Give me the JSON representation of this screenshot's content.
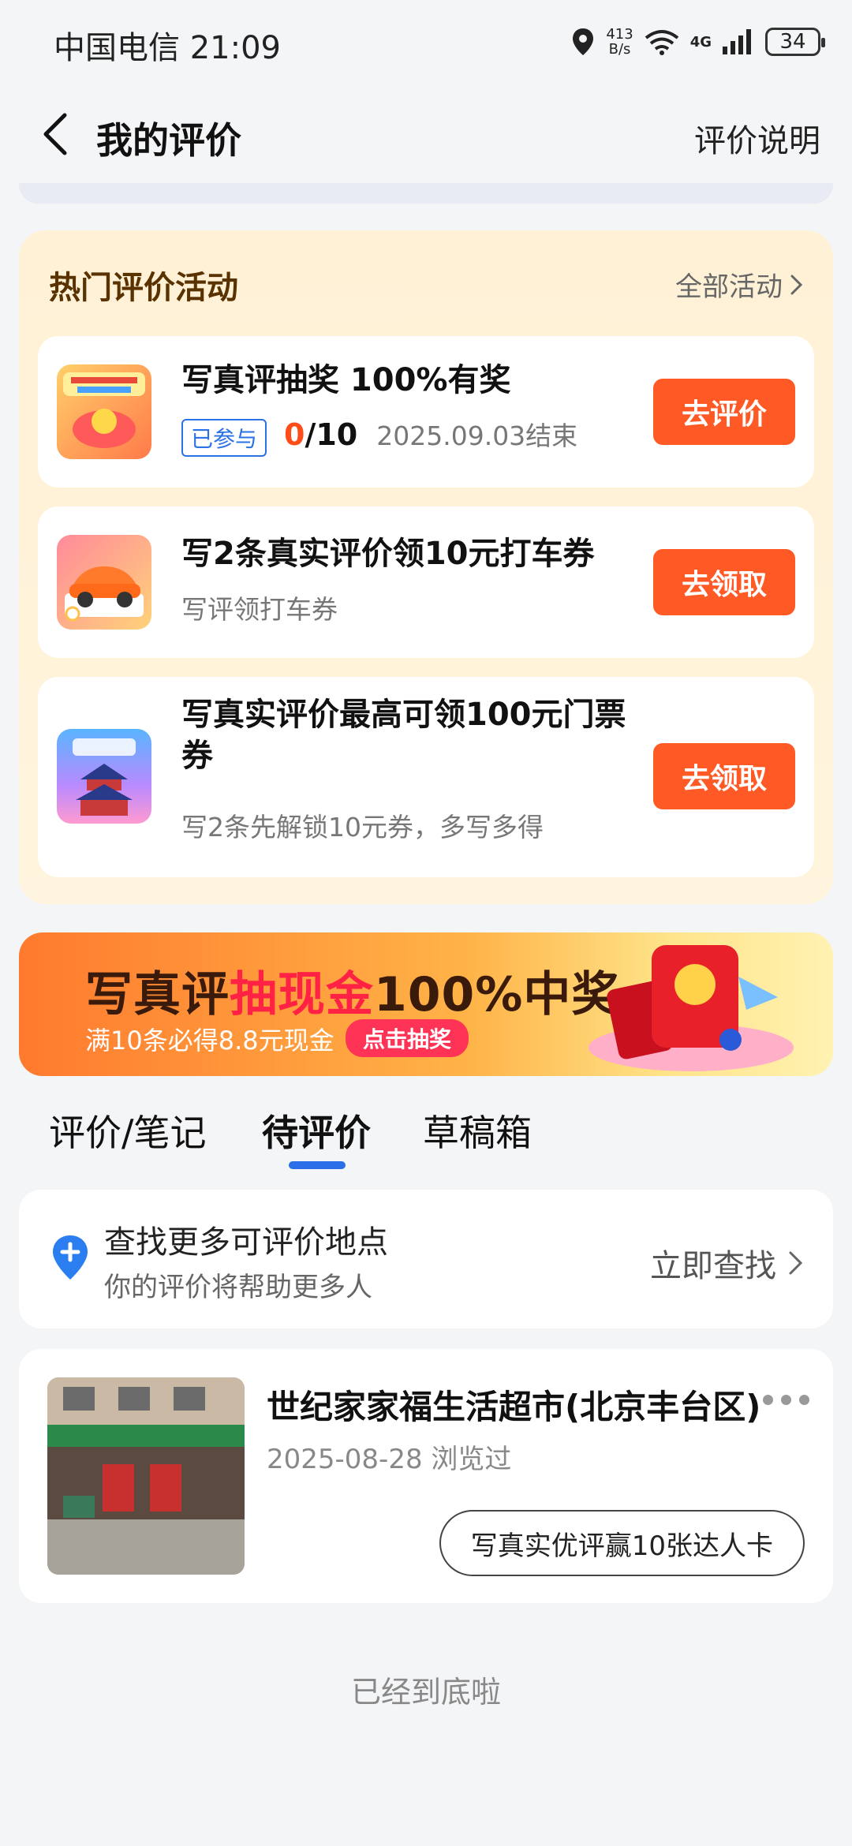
{
  "status_bar": {
    "carrier_time": "中国电信 21:09",
    "speed_value": "413",
    "speed_unit": "B/s",
    "network": "4G",
    "battery": "34"
  },
  "header": {
    "title": "我的评价",
    "link": "评价说明"
  },
  "activities": {
    "title": "热门评价活动",
    "all_link": "全部活动",
    "items": [
      {
        "title": "写真评抽奖 100%有奖",
        "badge": "已参与",
        "progress_current": "0",
        "progress_total": "/10",
        "end_date": "2025.09.03结束",
        "button": "去评价"
      },
      {
        "title": "写2条真实评价领10元打车券",
        "subtitle": "写评领打车券",
        "button": "去领取"
      },
      {
        "title_line1": "写真实评价最高可领100元门票",
        "title_line2": "券",
        "subtitle": "写2条先解锁10元券，多写多得",
        "button": "去领取"
      }
    ]
  },
  "banner": {
    "headline_part1": "写真评",
    "headline_highlight": "抽现金",
    "headline_part2": "100%中奖",
    "subtitle": "满10条必得8.8元现金",
    "button": "点击抽奖"
  },
  "tabs": [
    {
      "label": "评价/笔记",
      "active": false
    },
    {
      "label": "待评价",
      "active": true
    },
    {
      "label": "草稿箱",
      "active": false
    }
  ],
  "find_card": {
    "title": "查找更多可评价地点",
    "subtitle": "你的评价将帮助更多人",
    "link": "立即查找"
  },
  "place": {
    "name": "世纪家家福生活超市(北京丰台区)",
    "meta": "2025-08-28 浏览过",
    "button": "写真实优评赢10张达人卡"
  },
  "footer": "已经到底啦",
  "colors": {
    "accent_orange": "#ff5a26",
    "tab_indicator": "#2a6fe8",
    "activity_bg": "#fff1d6"
  }
}
